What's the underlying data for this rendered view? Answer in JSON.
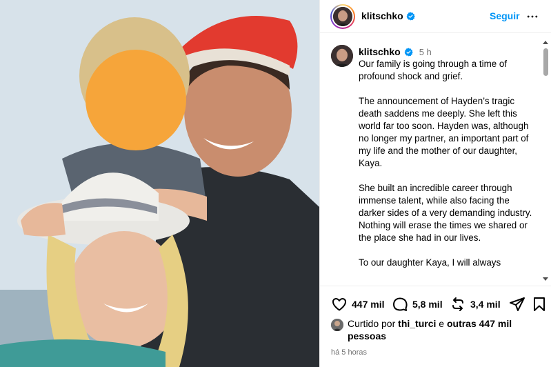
{
  "post": {
    "username": "klitschko",
    "follow_label": "Seguir",
    "time_ago": "5 h",
    "caption": "Our family is going through a time of profound shock and grief.\n\nThe announcement of Hayden’s tragic death saddens me deeply. She left this world far too soon. Hayden was, although no longer my partner, an important part of my life and the mother of our daughter, Kaya.\n\nShe built an incredible career through immense talent, while also facing the darker sides of a very demanding industry. Nothing will erase the times we shared or the place she had in our lives.\n\nTo our daughter Kaya, I will always"
  },
  "actions": {
    "likes": "447 mil",
    "comments": "5,8 mil",
    "reposts": "3,4 mil"
  },
  "liked_by": {
    "prefix": "Curtido por",
    "user": "thi_turci",
    "conjunction": "e",
    "others": "outras 447 mil pessoas"
  },
  "timestamp": "há 5 horas",
  "icons": [
    "verified-badge-icon",
    "more-options-icon",
    "heart-icon",
    "comment-icon",
    "repost-icon",
    "share-icon",
    "bookmark-icon"
  ],
  "colors": {
    "link": "#0095f6",
    "verified": "#0095f6",
    "muted": "#737373"
  }
}
